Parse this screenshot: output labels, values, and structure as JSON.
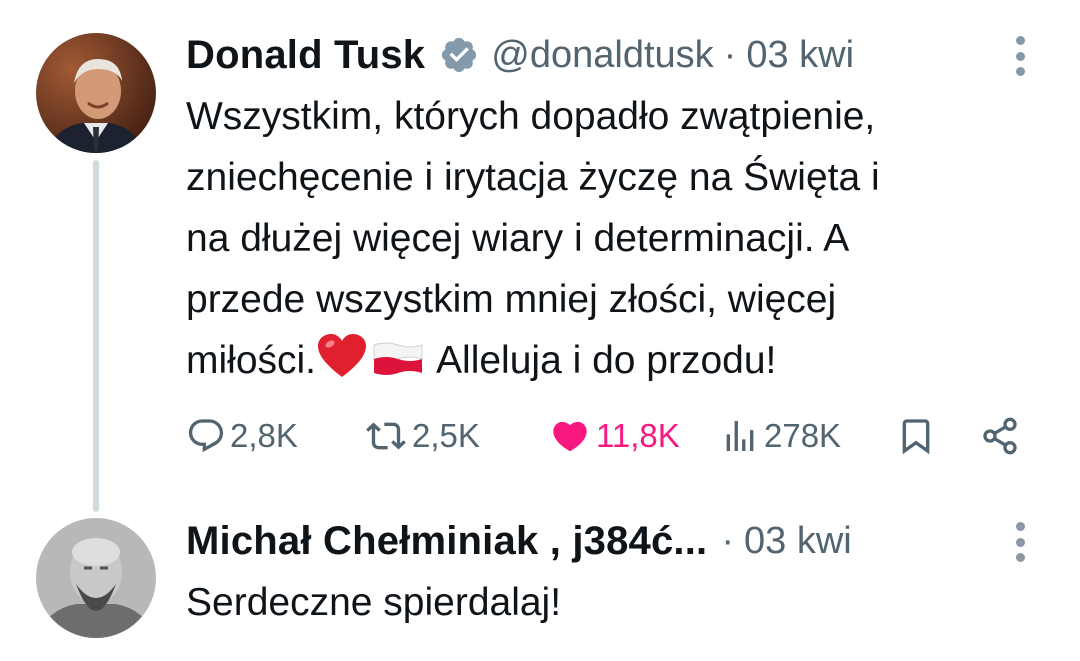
{
  "tweet": {
    "author_name": "Donald Tusk",
    "handle": "@donaldtusk",
    "separator": "·",
    "time": "03 kwi",
    "text_lines": [
      "Wszystkim, których dopadło zwątpienie,",
      "zniechęcenie i irytacja życzę na Święta i",
      "na dłużej więcej wiary i determinacji. A",
      "przede wszystkim mniej złości, więcej",
      "miłości."
    ],
    "text_tail": "Alleluja i do przodu!",
    "emojis": [
      "red-heart",
      "flag-poland"
    ],
    "verified": true,
    "actions": {
      "replies": "2,8K",
      "reposts": "2,5K",
      "likes": "11,8K",
      "views": "278K"
    },
    "colors": {
      "like": "#f91880",
      "verified": "#829aab",
      "muted": "#536471"
    }
  },
  "reply": {
    "author_name": "Michał Chełminiak , j384ć...",
    "separator": "·",
    "time": "03 kwi",
    "text": "Serdeczne spierdalaj!"
  }
}
